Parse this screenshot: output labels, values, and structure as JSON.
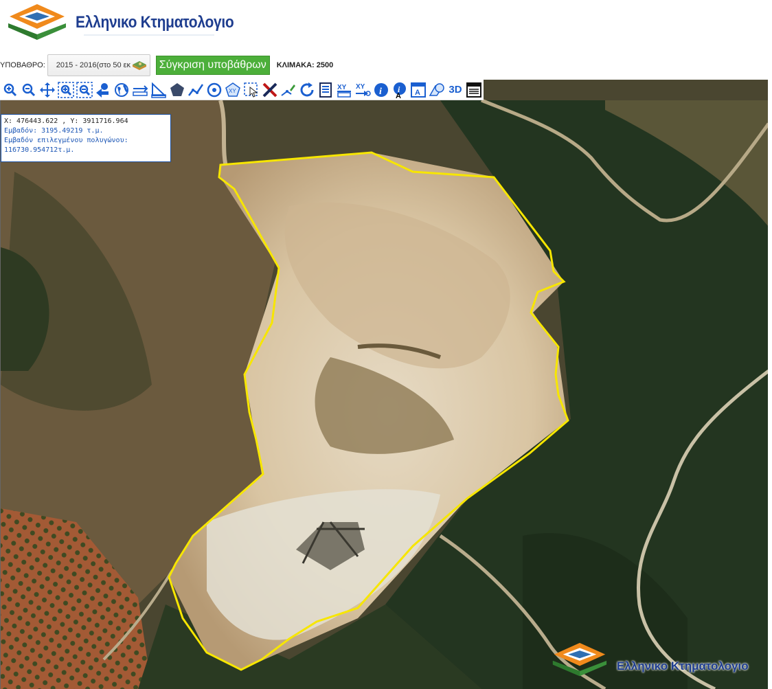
{
  "header": {
    "logo_text": "Ελληνικο Κτηματολογιο"
  },
  "controls": {
    "basemap_label": "ΥΠΟΒΑΘΡΟ:",
    "basemap_value": "2015 - 2016(στο 50 εκ",
    "compare_button": "Σύγκριση υποβάθρων",
    "scale_text": "ΚΛΙΜΑΚΑ: 2500"
  },
  "toolbar": {
    "tools": [
      "zoom-in-icon",
      "zoom-out-icon",
      "pan-icon",
      "zoom-box-in-icon",
      "zoom-box-out-icon",
      "previous-extent-icon",
      "globe-icon",
      "measure-distance-icon",
      "measure-area-icon",
      "polygon-icon",
      "polyline-icon",
      "circle-icon",
      "polygon-xy-icon",
      "select-icon",
      "delete-icon",
      "edit-vertex-icon",
      "refresh-icon",
      "document-icon",
      "xy-search-icon",
      "xy-goto-icon",
      "info-icon",
      "label-info-icon",
      "text-label-icon",
      "shapes-icon",
      "3d-icon",
      "layers-print-icon"
    ],
    "label_3d": "3D"
  },
  "infobox": {
    "coords": "X: 476443.622 , Y: 3911716.964",
    "area": "Εμβαδόν: 3195.49219 τ.μ.",
    "selected_area_label": "Εμβαδόν επιλεγμένου πολυγώνου:",
    "selected_area_value": "116730.954712τ.μ."
  },
  "footer": {
    "logo_text": "Ελληνικο Κτηματολογιο"
  },
  "colors": {
    "polygon_outline": "#f7e600",
    "brand_blue": "#1e3d8f",
    "compare_green": "#4caf3a",
    "info_blue": "#1a55b5"
  }
}
